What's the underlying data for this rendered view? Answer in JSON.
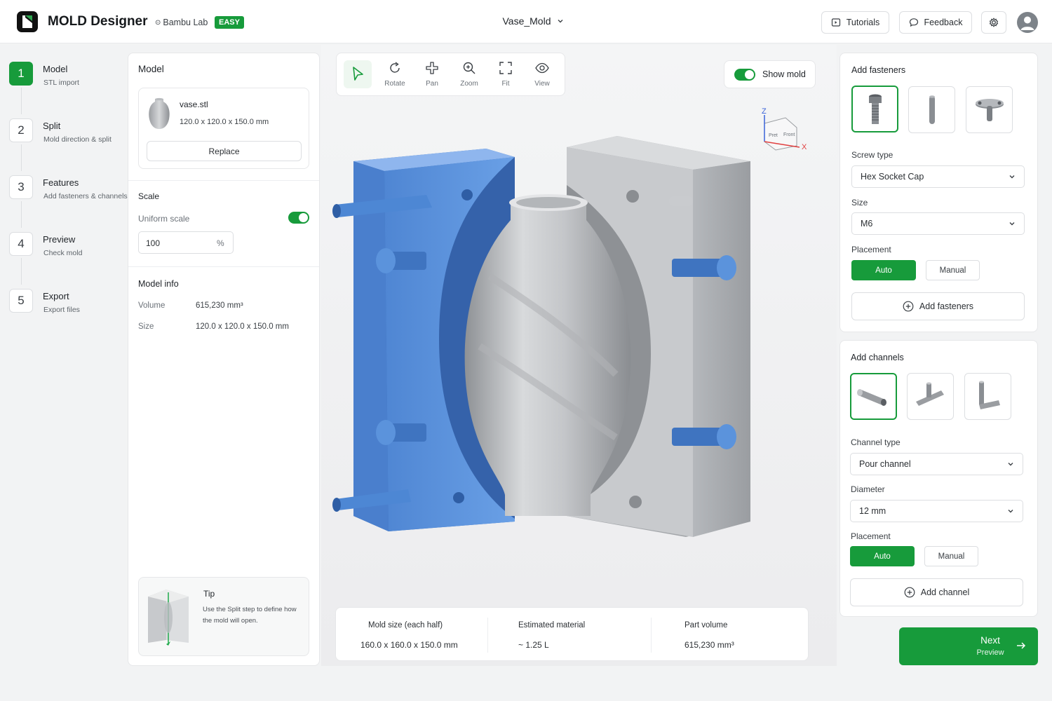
{
  "header": {
    "app_title": "MOLD Designer",
    "brand": "Bambu Lab",
    "badge": "EASY",
    "project_name": "Vase_Mold",
    "tutorials_label": "Tutorials",
    "feedback_label": "Feedback"
  },
  "steps": [
    {
      "num": "1",
      "title": "Model",
      "sub": "STL import",
      "active": true
    },
    {
      "num": "2",
      "title": "Split",
      "sub": "Mold direction & split",
      "active": false
    },
    {
      "num": "3",
      "title": "Features",
      "sub": "Add fasteners & channels",
      "active": false
    },
    {
      "num": "4",
      "title": "Preview",
      "sub": "Check mold",
      "active": false
    },
    {
      "num": "5",
      "title": "Export",
      "sub": "Export files",
      "active": false
    }
  ],
  "model_panel": {
    "title": "Model",
    "file_name": "vase.stl",
    "file_dims": "120.0 x 120.0 x 150.0 mm",
    "replace_label": "Replace",
    "scale_title": "Scale",
    "uniform_scale_label": "Uniform scale",
    "uniform_scale_on": true,
    "scale_value": "100",
    "scale_unit": "%",
    "info_title": "Model info",
    "volume_label": "Volume",
    "volume_value": "615,230 mm³",
    "size_label": "Size",
    "size_value": "120.0 x 120.0 x 150.0 mm",
    "tip_title": "Tip",
    "tip_text": "Use the Split step to define how the mold will open."
  },
  "toolbar": {
    "rotate": "Rotate",
    "pan": "Pan",
    "zoom": "Zoom",
    "fit": "Fit",
    "view": "View"
  },
  "viewport": {
    "show_mold_label": "Show mold",
    "show_mold_on": true,
    "axis_z": "Z",
    "axis_x": "X",
    "cube_face_front": "Front",
    "cube_face_left": "Pret"
  },
  "stats": {
    "mold_size_label": "Mold size (each half)",
    "mold_size_value": "160.0 x 160.0 x 150.0 mm",
    "material_label": "Estimated material",
    "material_value": "~ 1.25 L",
    "part_volume_label": "Part volume",
    "part_volume_value": "615,230 mm³"
  },
  "fasteners": {
    "title": "Add fasteners",
    "screw_type_label": "Screw type",
    "screw_type_value": "Hex Socket Cap",
    "size_label": "Size",
    "size_value": "M6",
    "placement_label": "Placement",
    "auto_label": "Auto",
    "manual_label": "Manual",
    "add_label": "Add fasteners"
  },
  "channels": {
    "title": "Add channels",
    "channel_type_label": "Channel type",
    "channel_type_value": "Pour channel",
    "diameter_label": "Diameter",
    "diameter_value": "12 mm",
    "placement_label": "Placement",
    "auto_label": "Auto",
    "manual_label": "Manual",
    "add_label": "Add channel"
  },
  "next": {
    "label": "Next",
    "sub": "Preview"
  },
  "colors": {
    "accent": "#179b3b",
    "mold_blue": "#5b93dc",
    "mold_gray": "#a9acb0"
  }
}
